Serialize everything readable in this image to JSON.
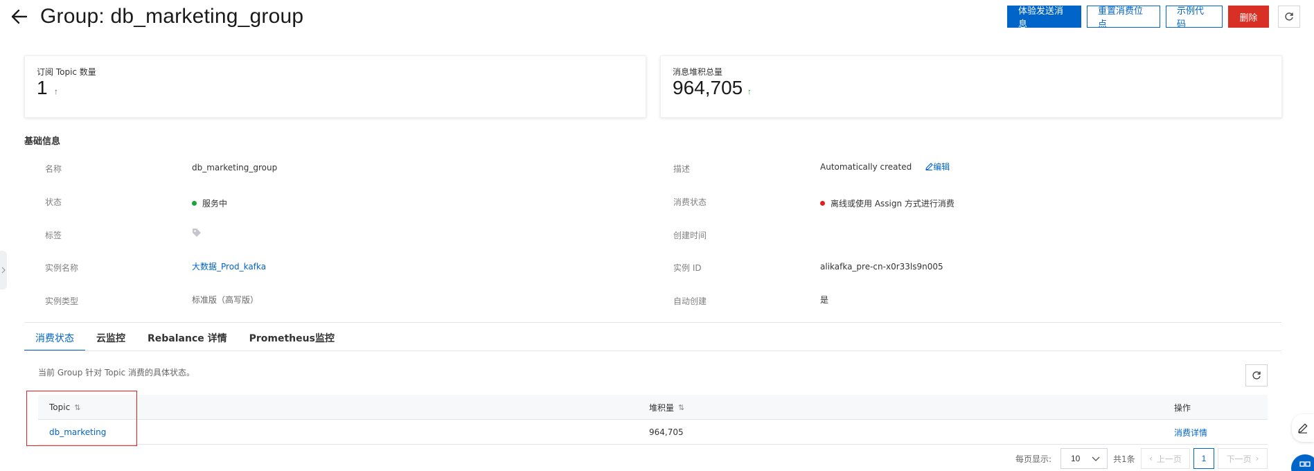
{
  "header": {
    "title": "Group: db_marketing_group",
    "buttons": {
      "send_test": "体验发送消息",
      "reset_offset": "重置消费位点",
      "sample_code": "示例代码",
      "delete": "删除"
    }
  },
  "stats": [
    {
      "label": "订阅 Topic 数量",
      "value": "1",
      "trend": "↑",
      "trend_color": "#555555"
    },
    {
      "label": "消息堆积总量",
      "value": "964,705",
      "trend": "↑",
      "trend_color": "#1a9e3a"
    }
  ],
  "basic_info": {
    "title": "基础信息",
    "left": [
      {
        "label": "名称",
        "value": "db_marketing_group"
      },
      {
        "label": "状态",
        "value": "服务中",
        "status_color": "#1aa33a"
      },
      {
        "label": "标签",
        "value": "",
        "icon": "tag-icon"
      },
      {
        "label": "实例名称",
        "value": "大数据_Prod_kafka"
      },
      {
        "label": "实例类型",
        "value": "标准版（高写版）"
      }
    ],
    "right": [
      {
        "label": "描述",
        "value": "Automatically created",
        "action": "编辑"
      },
      {
        "label": "消费状态",
        "value": "离线或使用 Assign 方式进行消费",
        "status_color": "#e02020"
      },
      {
        "label": "创建时间",
        "value": ""
      },
      {
        "label": "实例 ID",
        "value": "alikafka_pre-cn-x0r33ls9n005"
      },
      {
        "label": "自动创建",
        "value": "是"
      }
    ]
  },
  "tabs": [
    {
      "label": "消费状态",
      "active": true
    },
    {
      "label": "云监控",
      "active": false
    },
    {
      "label": "Rebalance 详情",
      "active": false
    },
    {
      "label": "Prometheus监控",
      "active": false
    }
  ],
  "table": {
    "description": "当前 Group 针对 Topic 消费的具体状态。",
    "columns": [
      "Topic",
      "堆积量",
      "操作"
    ],
    "rows": [
      {
        "topic": "db_marketing",
        "backlog": "964,705",
        "action": "消费详情"
      }
    ]
  },
  "pagination": {
    "per_page_label": "每页显示:",
    "per_page": "10",
    "total": "共1条",
    "prev": "上一页",
    "page": "1",
    "next": "下一页"
  },
  "colors": {
    "primary": "#0064c8",
    "danger": "#d93026"
  }
}
